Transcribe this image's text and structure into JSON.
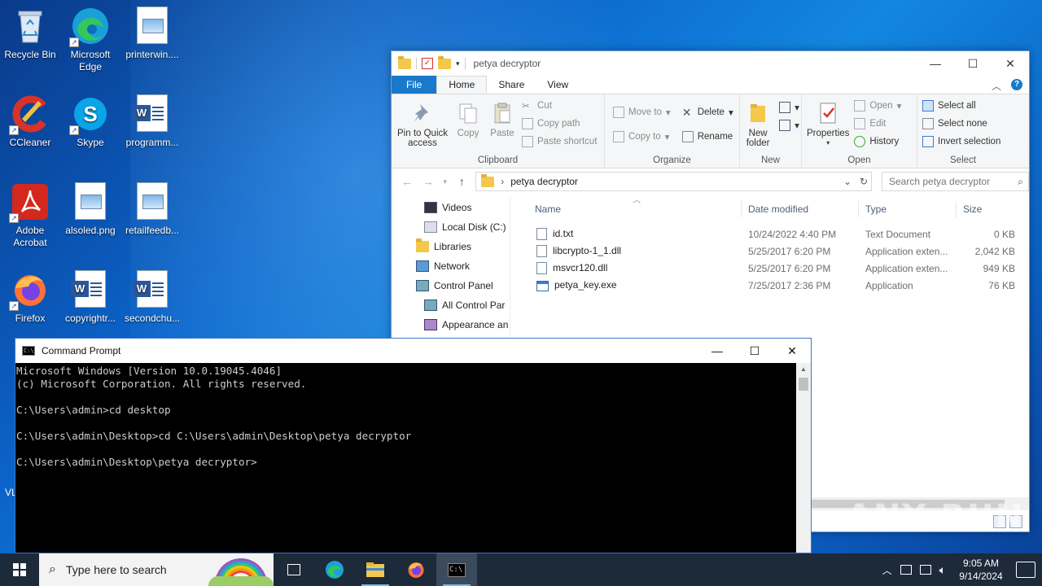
{
  "desktop": {
    "icons": [
      {
        "label": "Recycle Bin"
      },
      {
        "label": "Microsoft Edge"
      },
      {
        "label": "printerwin...."
      },
      {
        "label": "CCleaner"
      },
      {
        "label": "Skype"
      },
      {
        "label": "programm..."
      },
      {
        "label": "Adobe Acrobat"
      },
      {
        "label": "alsoled.png"
      },
      {
        "label": "retailfeedb..."
      },
      {
        "label": "Firefox"
      },
      {
        "label": "copyrightr..."
      },
      {
        "label": "secondchu..."
      }
    ],
    "partial_label": "VL"
  },
  "explorer": {
    "title": "petya decryptor",
    "tabs": [
      "File",
      "Home",
      "Share",
      "View"
    ],
    "ribbon": {
      "clipboard": {
        "name": "Clipboard",
        "pin": "Pin to Quick access",
        "copy": "Copy",
        "paste": "Paste",
        "cut": "Cut",
        "copy_path": "Copy path",
        "paste_shortcut": "Paste shortcut"
      },
      "organize": {
        "name": "Organize",
        "move_to": "Move to",
        "copy_to": "Copy to",
        "delete": "Delete",
        "rename": "Rename"
      },
      "new": {
        "name": "New",
        "new_folder": "New folder"
      },
      "open": {
        "name": "Open",
        "properties": "Properties",
        "open": "Open",
        "edit": "Edit",
        "history": "History"
      },
      "select": {
        "name": "Select",
        "select_all": "Select all",
        "select_none": "Select none",
        "invert": "Invert selection"
      }
    },
    "address": {
      "path": "petya decryptor",
      "search_placeholder": "Search petya decryptor"
    },
    "nav": [
      "Videos",
      "Local Disk (C:)",
      "Libraries",
      "Network",
      "Control Panel",
      "All Control Par",
      "Appearance an"
    ],
    "columns": {
      "name": "Name",
      "date": "Date modified",
      "type": "Type",
      "size": "Size"
    },
    "files": [
      {
        "name": "id.txt",
        "date": "10/24/2022 4:40 PM",
        "type": "Text Document",
        "size": "0 KB",
        "icon": "text-file-icon"
      },
      {
        "name": "libcrypto-1_1.dll",
        "date": "5/25/2017 6:20 PM",
        "type": "Application exten...",
        "size": "2,042 KB",
        "icon": "dll-icon"
      },
      {
        "name": "msvcr120.dll",
        "date": "5/25/2017 6:20 PM",
        "type": "Application exten...",
        "size": "949 KB",
        "icon": "dll-icon"
      },
      {
        "name": "petya_key.exe",
        "date": "7/25/2017 2:36 PM",
        "type": "Application",
        "size": "76 KB",
        "icon": "exe-icon"
      }
    ]
  },
  "cmd": {
    "title": "Command Prompt",
    "lines": [
      "Microsoft Windows [Version 10.0.19045.4046]",
      "(c) Microsoft Corporation. All rights reserved.",
      "",
      "C:\\Users\\admin>cd desktop",
      "",
      "C:\\Users\\admin\\Desktop>cd C:\\Users\\admin\\Desktop\\petya decryptor",
      "",
      "C:\\Users\\admin\\Desktop\\petya decryptor>"
    ]
  },
  "taskbar": {
    "search_placeholder": "Type here to search",
    "time": "9:05 AM",
    "date": "9/14/2024"
  },
  "watermark": "ANY RUN"
}
